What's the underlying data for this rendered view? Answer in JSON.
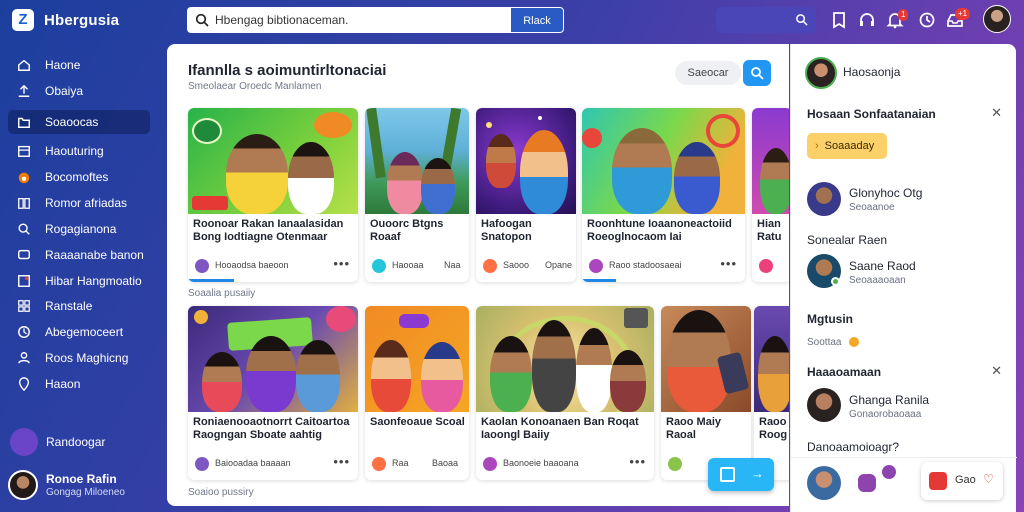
{
  "app": {
    "logo_letter": "Z",
    "brand": "Hbergusia"
  },
  "search": {
    "value": "Hbengag bibtionaceman.",
    "button": "Rlack"
  },
  "top_badges": {
    "bell": "1",
    "inbox": "+1"
  },
  "sidebar": {
    "items": [
      {
        "label": "Haone",
        "icon": "home-icon"
      },
      {
        "label": "Obaiya",
        "icon": "upload-icon"
      },
      {
        "label": "Soaoocas",
        "icon": "folder-icon",
        "active": true
      },
      {
        "label": "Haouturing",
        "icon": "calendar-icon"
      },
      {
        "label": "Bocomoftes",
        "icon": "fire-icon"
      },
      {
        "label": "Romor afriadas",
        "icon": "book-icon"
      },
      {
        "label": "Rogagianona",
        "icon": "search-icon"
      },
      {
        "label": "Raaaanabe banon",
        "icon": "chat-icon"
      },
      {
        "label": "Hibar Hangmoatio",
        "icon": "dashboard-icon"
      },
      {
        "label": "Ranstale",
        "icon": "grid-icon"
      },
      {
        "label": "Abegemoceert",
        "icon": "clock-icon"
      },
      {
        "label": "Roos Maghicng",
        "icon": "user-icon"
      },
      {
        "label": "Haaon",
        "icon": "map-pin-icon"
      }
    ],
    "profile_label": "Randoogar",
    "user": {
      "name": "Ronoe Rafin",
      "subtitle": "Gongag Miloeneo"
    }
  },
  "main": {
    "title": "Ifannlla s aoimuntirltonaciai",
    "subtitle": "Smeolaear Oroedc Manlamen",
    "filter_label": "Saeocar",
    "section_1": "Soaalia pusaiiy",
    "section_2": "Soaioo pussiry",
    "row1": [
      {
        "title": "Roonoar Rakan Ianaalasidan Bong Iodtiagne Otenmaar",
        "meta": "Hooaodsa baeoon"
      },
      {
        "title": "Ouoorc Btgns Roaaf",
        "meta": "Haooaa",
        "meta2": "Naa"
      },
      {
        "title": "Hafoogan Snatopon",
        "meta": "Saooo",
        "meta2": "Opane"
      },
      {
        "title": "Roonhtune Ioaanoneactoiid Roeoglnocaom Iai",
        "meta": "Raoo stadoosaeai"
      },
      {
        "title": "Hian Ratu",
        "meta": ""
      }
    ],
    "row2": [
      {
        "title": "Roniaenooaotnorrt Caitoartoa Raogngan Sboate aahtig",
        "meta": "Baiooadaa baaaan"
      },
      {
        "title": "Saonfeoaue Scoal",
        "meta": "Raa",
        "meta2": "Baoaa"
      },
      {
        "title": "Kaolan Konoanaen Ban Roqat Iaoongl Baiiy",
        "meta": "Baonoeie baaoana"
      },
      {
        "title": "Raoo Maiy Raoal",
        "meta": ""
      },
      {
        "title": "Raoo Roog",
        "meta": ""
      }
    ]
  },
  "right_panel": {
    "user": {
      "name": "Haosaonja"
    },
    "section_title": "Hosaan Sonfaatanaian",
    "follow_label": "Soaaaday",
    "suggest1": {
      "name": "Glonyhoc Otg",
      "sub": "Seoaanoe"
    },
    "section2": "Sonealar Raen",
    "suggest2": {
      "name": "Saane Raod",
      "sub": "Seoaaaoaan"
    },
    "section3": "Mgtusin",
    "section3_sub": "Soottaa",
    "section4": "Haaaoamaan",
    "suggest3": {
      "name": "Ghanga Ranila",
      "sub": "Gonaorobaoaaa"
    },
    "section5": "Danoaamoioagr?",
    "chip_label": "Gao"
  },
  "colors": {
    "accent": "#2196f3",
    "brand_blue": "#1c3f9e",
    "follow_yellow": "#fcd16a",
    "badge_red": "#e53935"
  }
}
